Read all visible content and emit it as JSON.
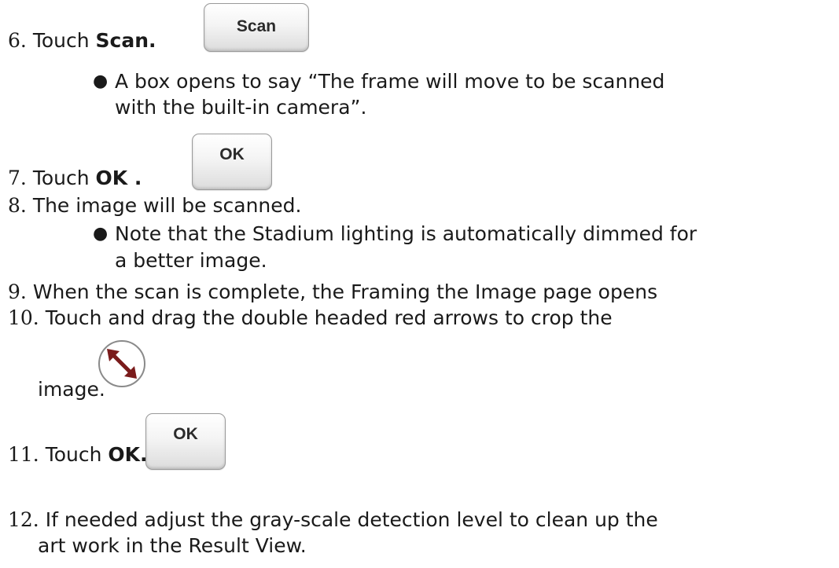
{
  "steps": [
    {
      "num": "6.",
      "pre": "Touch ",
      "bold": "Scan.",
      "button": "Scan"
    },
    {
      "bullet": "A box opens to say “The frame will move to be scanned",
      "cont": "with the built-in camera”."
    },
    {
      "num": "7.",
      "pre": "Touch ",
      "bold": "OK .",
      "button": "OK"
    },
    {
      "num": "8.",
      "text": "The image will be scanned."
    },
    {
      "bullet": "Note that the Stadium lighting is automatically dimmed for",
      "cont": "a better image."
    },
    {
      "num": "9.",
      "text": "When the scan is complete, the Framing the Image page opens"
    },
    {
      "num": "10.",
      "text": "Touch and drag the double headed red arrows to crop the",
      "cont": "image."
    },
    {
      "num": "11.",
      "pre": "Touch ",
      "bold": "OK.",
      "button": "OK"
    },
    {
      "num": "12.",
      "text": "If needed adjust the gray-scale detection level to clean up the",
      "cont": "art work in the Result View."
    }
  ],
  "colors": {
    "arrow": "#7a1b1b"
  },
  "icons": {
    "resize": "double-headed-arrow-icon"
  }
}
